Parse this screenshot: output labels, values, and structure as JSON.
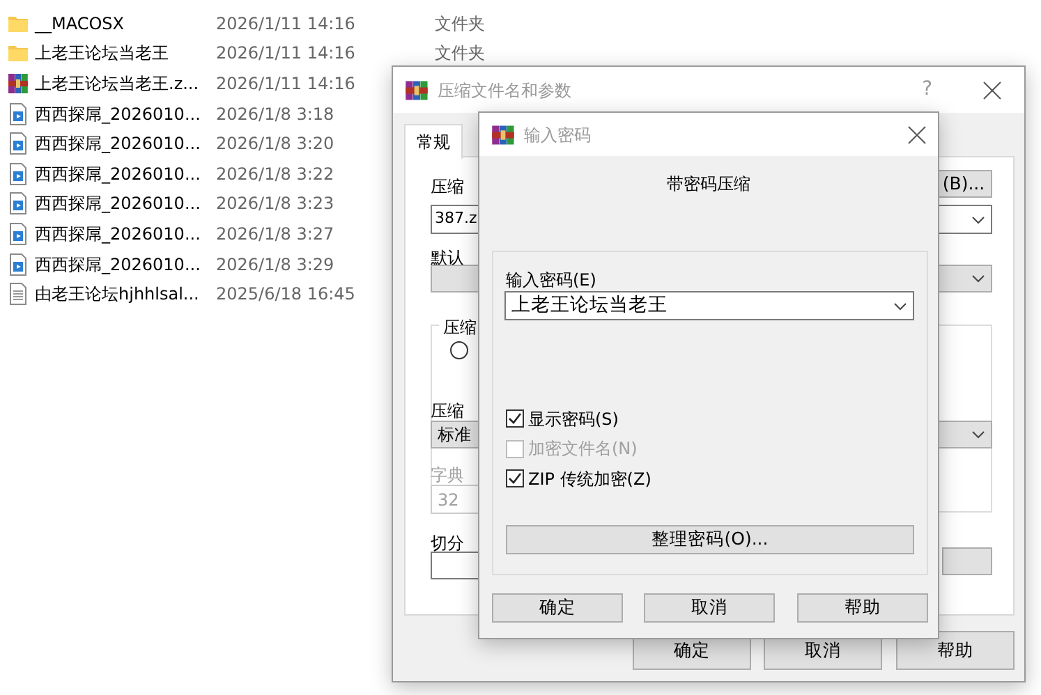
{
  "files": [
    {
      "kind": "folder",
      "name": "__MACOSX",
      "date": "2026/1/11 14:16",
      "type": "文件夹"
    },
    {
      "kind": "folder",
      "name": "上老王论坛当老王",
      "date": "2026/1/11 14:16",
      "type": "文件夹"
    },
    {
      "kind": "archive",
      "name": "上老王论坛当老王.z...",
      "date": "2026/1/11 14:16"
    },
    {
      "kind": "video",
      "name": "西西探屌_2026010...",
      "date": "2026/1/8 3:18"
    },
    {
      "kind": "video",
      "name": "西西探屌_2026010...",
      "date": "2026/1/8 3:20"
    },
    {
      "kind": "video",
      "name": "西西探屌_2026010...",
      "date": "2026/1/8 3:22"
    },
    {
      "kind": "video",
      "name": "西西探屌_2026010...",
      "date": "2026/1/8 3:23"
    },
    {
      "kind": "video",
      "name": "西西探屌_2026010...",
      "date": "2026/1/8 3:27"
    },
    {
      "kind": "video",
      "name": "西西探屌_2026010...",
      "date": "2026/1/8 3:29"
    },
    {
      "kind": "text",
      "name": "由老王论坛hjhhlsal...",
      "date": "2025/6/18 16:45"
    }
  ],
  "archive_dialog": {
    "title": "压缩文件名和参数",
    "help": "?",
    "tabs": [
      {
        "label": "常规",
        "selected": true
      }
    ],
    "archive_name_label": "压缩",
    "browse_button": "(B)...",
    "archive_name": "387.z",
    "profile_label": "默认",
    "format_group": "压缩",
    "format_option": {
      "selected": false
    },
    "method_label": "压缩",
    "method": "标准",
    "dictionary_label": "字典",
    "dictionary": "32",
    "split_label": "切分",
    "buttons": [
      "确定",
      "取消",
      "帮助"
    ]
  },
  "password_dialog": {
    "title": "输入密码",
    "heading": "带密码压缩",
    "password_label": "输入密码(E)",
    "password": "上老王论坛当老王",
    "options": [
      {
        "label": "显示密码(S)",
        "checked": true,
        "disabled": false
      },
      {
        "label": "加密文件名(N)",
        "checked": false,
        "disabled": true
      },
      {
        "label": "ZIP 传统加密(Z)",
        "checked": true,
        "disabled": false
      }
    ],
    "organize_button": "整理密码(O)...",
    "buttons": [
      "确定",
      "取消",
      "帮助"
    ]
  }
}
